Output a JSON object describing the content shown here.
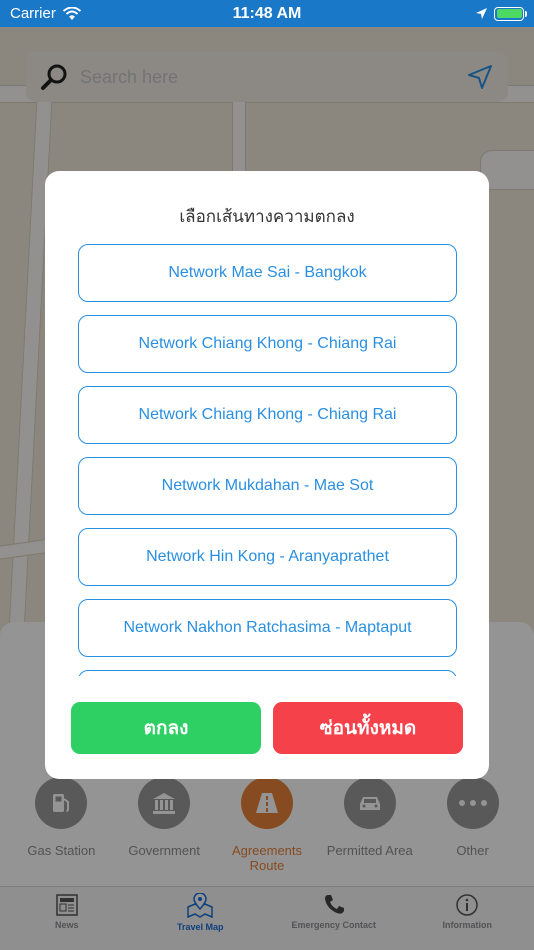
{
  "status_bar": {
    "carrier": "Carrier",
    "time": "11:48 AM",
    "battery_level": 1.0
  },
  "search": {
    "placeholder": "Search here",
    "search_icon": "magnifier-icon",
    "location_icon": "navigation-arrow-icon"
  },
  "dialog": {
    "title": "เลือกเส้นทางความตกลง",
    "routes": [
      "Network Mae Sai - Bangkok",
      "Network Chiang Khong - Chiang Rai",
      "Network Chiang Khong - Chiang Rai",
      "Network Mukdahan - Mae Sot",
      "Network Hin Kong - Aranyaprathet",
      "Network Nakhon Ratchasima - Maptaput"
    ],
    "ok_label": "ตกลง",
    "hide_all_label": "ซ่อนทั้งหมด"
  },
  "categories": [
    {
      "label": "Gas Station",
      "icon": "gas-pump-icon",
      "active": false
    },
    {
      "label": "Government",
      "icon": "government-building-icon",
      "active": false
    },
    {
      "label": "Agreements Route",
      "icon": "road-icon",
      "active": true
    },
    {
      "label": "Permitted Area",
      "icon": "car-icon",
      "active": false
    },
    {
      "label": "Other",
      "icon": "more-dots-icon",
      "active": false
    }
  ],
  "tabs": [
    {
      "label": "News",
      "icon": "newspaper-icon",
      "active": false
    },
    {
      "label": "Travel Map",
      "icon": "map-pin-icon",
      "active": true
    },
    {
      "label": "Emergency Contact",
      "icon": "phone-icon",
      "active": false
    },
    {
      "label": "Information",
      "icon": "info-icon",
      "active": false
    }
  ],
  "colors": {
    "accent_blue": "#2a8fe0",
    "ok_green": "#2ed064",
    "hide_red": "#f5414a",
    "active_orange": "#e8813a"
  }
}
